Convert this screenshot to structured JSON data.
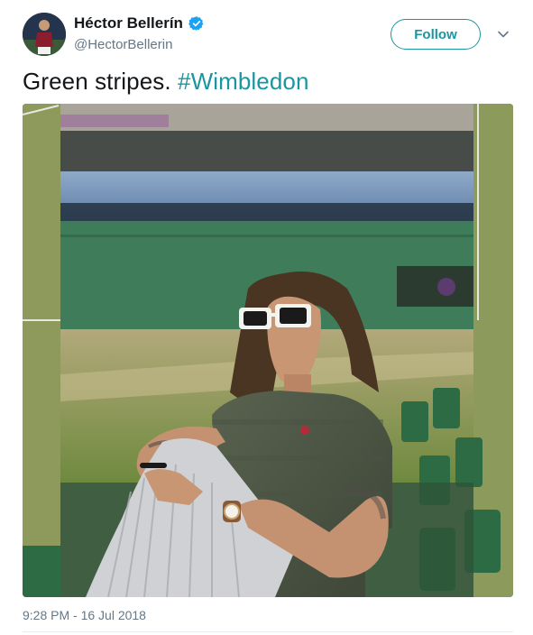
{
  "author": {
    "display_name": "Héctor Bellerín",
    "handle": "@HectorBellerin",
    "verified": true,
    "avatar_icon": "player-avatar-icon"
  },
  "actions": {
    "follow_label": "Follow",
    "more_icon": "chevron-down-icon"
  },
  "tweet": {
    "text": "Green stripes. ",
    "hashtag": "#Wimbledon",
    "timestamp": "9:28 PM - 16 Jul 2018"
  },
  "colors": {
    "accent": "#1b95a0",
    "verified": "#1da1f2",
    "secondary_text": "#657786"
  }
}
